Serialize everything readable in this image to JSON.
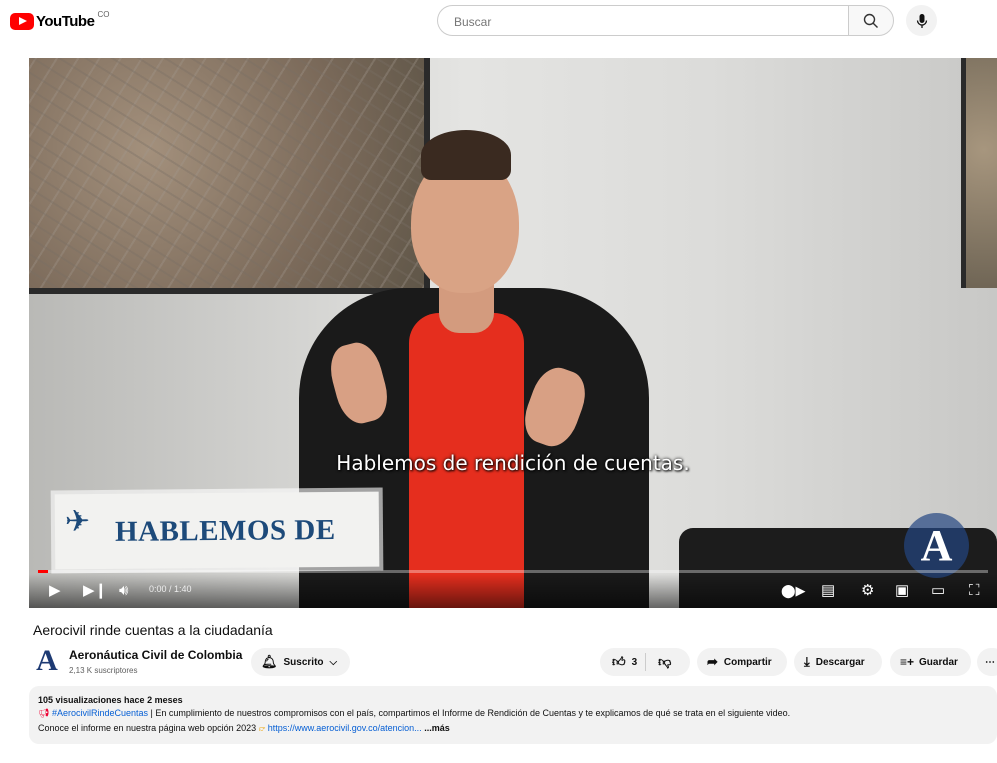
{
  "header": {
    "logo_text": "YouTube",
    "country_code": "CO",
    "search_placeholder": "Buscar"
  },
  "player": {
    "caption": "Hablemos de rendición de cuentas.",
    "overlay_text": "HABLEMOS DE",
    "time": "0:00 / 1:40",
    "progress": 0.01
  },
  "video": {
    "title": "Aerocivil rinde cuentas a la ciudadanía",
    "channel_name": "Aeronáutica Civil de Colombia",
    "subscribers": "2,13 K suscriptores",
    "subscribe_label": "Suscrito",
    "like_count": "3",
    "share_label": "Compartir",
    "download_label": "Descargar",
    "save_label": "Guardar"
  },
  "description": {
    "meta": "105 visualizaciones  hace 2 meses",
    "hashtag": "#AerocivilRindeCuentas",
    "line1_rest": " | En cumplimiento de nuestros compromisos con el país, compartimos el Informe de Rendición de Cuentas y te explicamos de qué se trata en el siguiente video.",
    "line2_text": "Conoce el informe en nuestra página web opción 2023 ",
    "link": "https://www.aerocivil.gov.co/atencion...",
    "more": "...más"
  },
  "colors": {
    "accent": "#ff0000",
    "link": "#065fd4"
  }
}
